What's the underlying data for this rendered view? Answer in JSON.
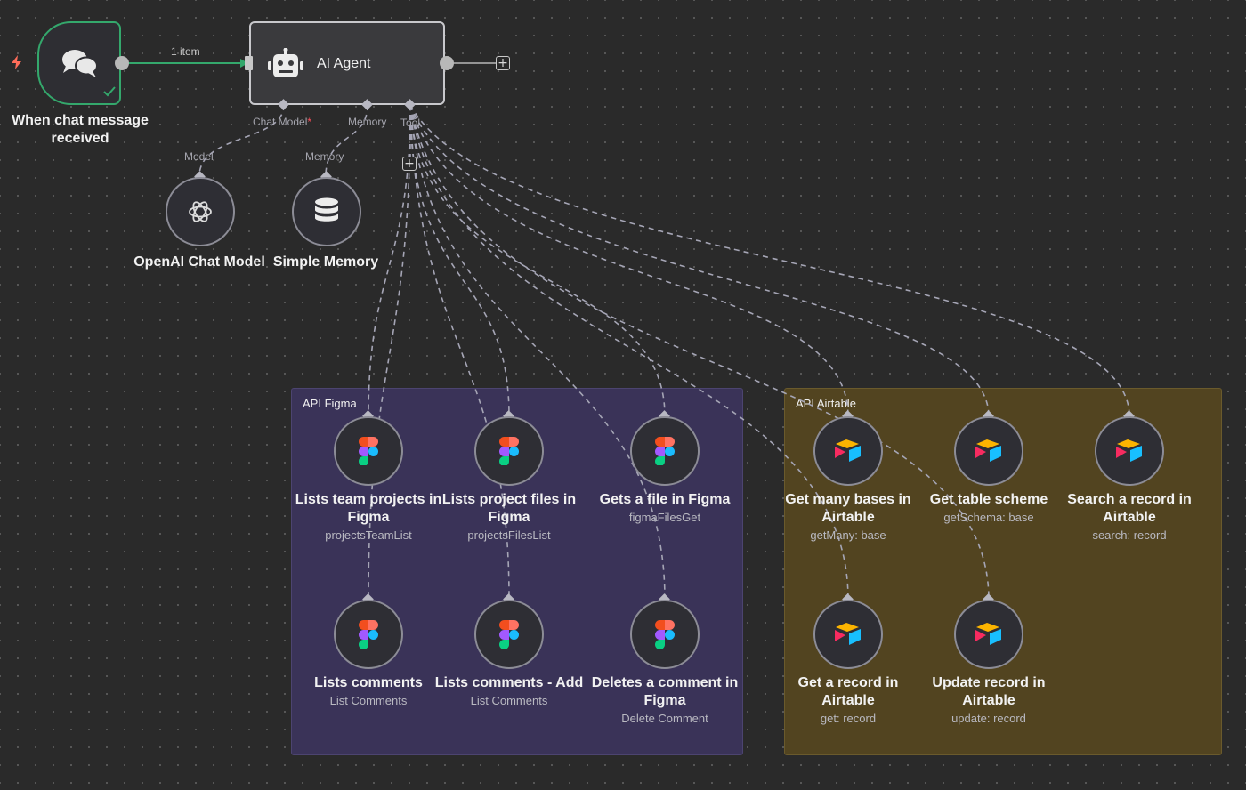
{
  "trigger": {
    "title": "When chat message received",
    "connection_label": "1 item"
  },
  "agent": {
    "title": "AI Agent",
    "ports": {
      "chat_model": "Chat Model",
      "chat_model_required": "*",
      "memory": "Memory",
      "tool": "Tool"
    }
  },
  "subnodes": {
    "model": {
      "port_label": "Model",
      "title": "OpenAI Chat Model"
    },
    "memory": {
      "port_label": "Memory",
      "title": "Simple Memory"
    }
  },
  "groups": {
    "figma": {
      "title": "API Figma",
      "color": "#3a3358"
    },
    "airtable": {
      "title": "API Airtable",
      "color": "#524420"
    }
  },
  "tools": [
    {
      "title": "Lists team projects in Figma",
      "subtitle": "projectsTeamList",
      "icon": "figma-icon"
    },
    {
      "title": "Lists project files in Figma",
      "subtitle": "projectsFilesList",
      "icon": "figma-icon"
    },
    {
      "title": "Gets a file in Figma",
      "subtitle": "figmaFilesGet",
      "icon": "figma-icon"
    },
    {
      "title": "Lists comments",
      "subtitle": "List Comments",
      "icon": "figma-icon"
    },
    {
      "title": "Lists comments - Add",
      "subtitle": "List Comments",
      "icon": "figma-icon"
    },
    {
      "title": "Deletes a comment in Figma",
      "subtitle": "Delete Comment",
      "icon": "figma-icon"
    },
    {
      "title": "Get many bases in Airtable",
      "subtitle": "getMany: base",
      "icon": "airtable-icon"
    },
    {
      "title": "Get table scheme",
      "subtitle": "getSchema: base",
      "icon": "airtable-icon"
    },
    {
      "title": "Search a record in Airtable",
      "subtitle": "search: record",
      "icon": "airtable-icon"
    },
    {
      "title": "Get a record in Airtable",
      "subtitle": "get: record",
      "icon": "airtable-icon"
    },
    {
      "title": "Update record in Airtable",
      "subtitle": "update: record",
      "icon": "airtable-icon"
    }
  ],
  "colors": {
    "accent_green": "#34a86c",
    "node_border": "#8c8c96",
    "required_red": "#ff4d5a"
  }
}
